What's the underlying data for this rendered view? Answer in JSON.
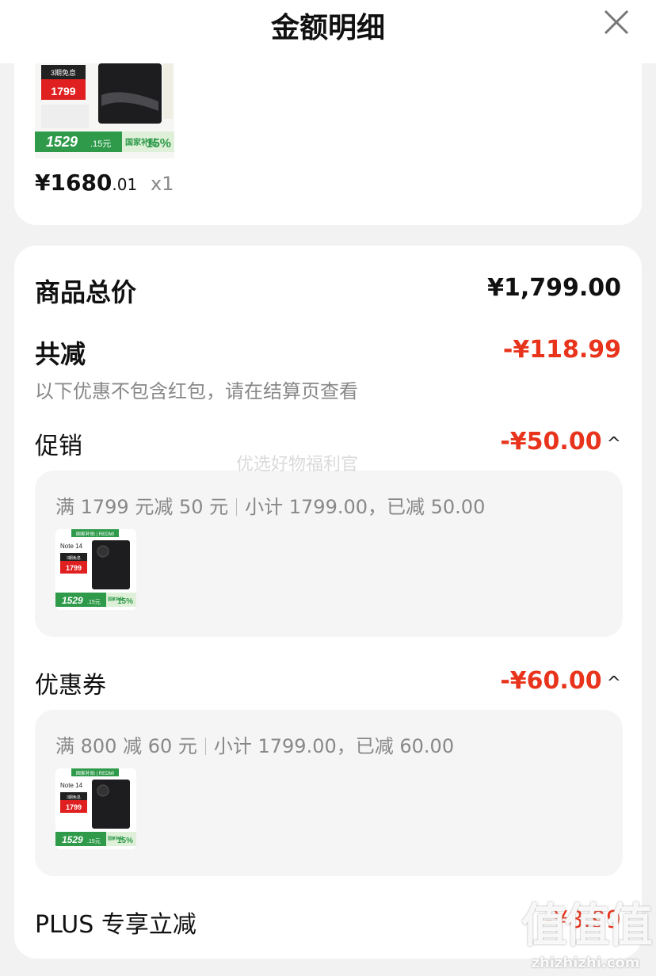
{
  "header": {
    "title": "金额明细"
  },
  "top_item": {
    "price_int": "¥1680",
    "price_dec": ".01",
    "qty": "x1",
    "thumb": {
      "tag": "3期免息",
      "price_tag": "1799",
      "bottom_price": "1529",
      "bottom_decimal": ".15元",
      "subsidy_label": "国家补贴",
      "subsidy_pct": "15%"
    }
  },
  "summary": {
    "total_label": "商品总价",
    "total_value": "¥1,799.00",
    "discount_label": "共减",
    "discount_value": "-¥118.99",
    "discount_note": "以下优惠不包含红包，请在结算页查看"
  },
  "promo": {
    "label": "促销",
    "value": "-¥50.00",
    "desc_a": "满 1799 元减 50 元",
    "desc_b": "小计 1799.00，已减 50.00"
  },
  "coupon": {
    "label": "优惠券",
    "value": "-¥60.00",
    "desc_a": "满 800 减 60 元",
    "desc_b": "小计 1799.00，已减 60.00"
  },
  "plus": {
    "label": "PLUS 专享立减",
    "value": "-¥8.99"
  },
  "thumb_small": {
    "brand": "国家补贴 | REDMI",
    "model": "Note 14",
    "tag": "3期免息",
    "price_tag": "1799",
    "bottom_price": "1529",
    "bottom_decimal": ".15元",
    "subsidy_label": "国家补贴",
    "subsidy_pct": "15%"
  },
  "watermark": "优选好物福利官",
  "site_watermark": {
    "logo": "值值值",
    "url": "zhizhizhi.com"
  },
  "colors": {
    "accent_red": "#e8341c",
    "subsidy_green": "#2e9a4a"
  }
}
